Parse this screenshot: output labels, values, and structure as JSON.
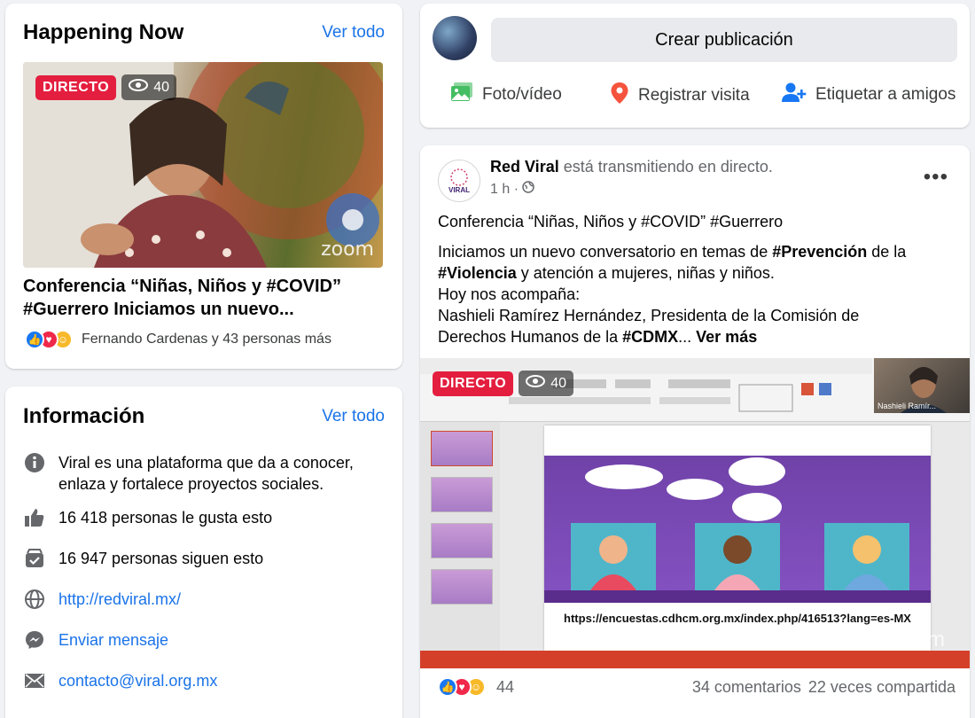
{
  "happening": {
    "title": "Happening Now",
    "see_all": "Ver todo",
    "badge_live": "DIRECTO",
    "viewers": "40",
    "watermark": "zoom",
    "video_title": "Conferencia “Niñas, Niños y #COVID” #Guerrero Iniciamos un nuevo...",
    "reactions_text": "Fernando Cardenas y 43 personas más"
  },
  "info": {
    "title": "Información",
    "see_all": "Ver todo",
    "items": [
      {
        "icon": "info-icon",
        "text": "Viral es una plataforma que da a conocer, enlaza y fortalece proyectos sociales."
      },
      {
        "icon": "thumbs-up-icon",
        "text": "16 418 personas le gusta esto"
      },
      {
        "icon": "follow-icon",
        "text": "16 947 personas siguen esto"
      },
      {
        "icon": "globe-icon",
        "text": "http://redviral.mx/"
      },
      {
        "icon": "messenger-icon",
        "text": "Enviar mensaje"
      },
      {
        "icon": "mail-icon",
        "text": "contacto@viral.org.mx"
      }
    ]
  },
  "create": {
    "button": "Crear publicación",
    "actions": [
      {
        "icon": "photo-video-icon",
        "label": "Foto/vídeo"
      },
      {
        "icon": "location-pin-icon",
        "label": "Registrar visita"
      },
      {
        "icon": "tag-friends-icon",
        "label": "Etiquetar a amigos"
      }
    ]
  },
  "post": {
    "author": "Red Viral",
    "action": "está transmitiendo en directo.",
    "time": "1 h ·",
    "avatar_logo": "VIRAL",
    "more": "•••",
    "line1": "Conferencia “Niñas, Niños y #COVID” #Guerrero",
    "para_a": "Iniciamos un nuevo conversatorio en temas de ",
    "tag_prevencion": "#Prevención",
    "para_b": " de la",
    "tag_violencia": "#Violencia",
    "para_c": " y atención a mujeres, niñas y niños.",
    "line_accompany": "Hoy nos acompaña:",
    "line_person_a": "Nashieli Ramírez Hernández, Presidenta de la Comisión de",
    "line_person_b": "Derechos Humanos de la ",
    "tag_cdmx": "#CDMX",
    "ellipsis": "...",
    "see_more": "Ver más",
    "badge_live": "DIRECTO",
    "viewers": "40",
    "slide_url": "https://encuestas.cdhcm.org.mx/index.php/416513?lang=es-MX",
    "cam_name": "Nashieli Ramír...",
    "zoom_mark": "zoom",
    "reaction_count": "44",
    "comments": "34 comentarios",
    "shares": "22 veces compartida"
  }
}
